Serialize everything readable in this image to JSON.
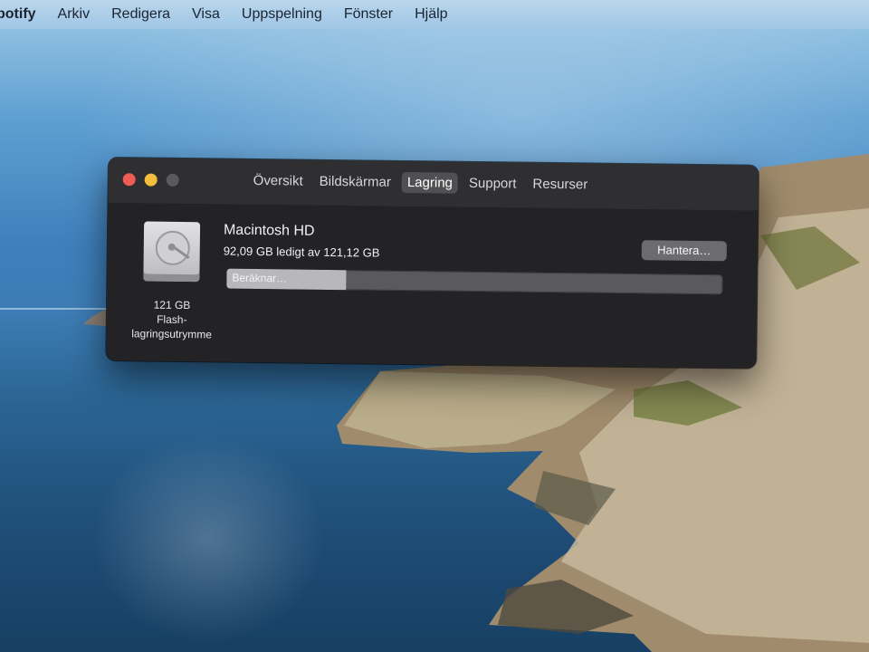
{
  "menubar": {
    "app_name": "potify",
    "items": [
      "Arkiv",
      "Redigera",
      "Visa",
      "Uppspelning",
      "Fönster",
      "Hjälp"
    ]
  },
  "window": {
    "tabs": [
      {
        "label": "Översikt",
        "active": false
      },
      {
        "label": "Bildskärmar",
        "active": false
      },
      {
        "label": "Lagring",
        "active": true
      },
      {
        "label": "Support",
        "active": false
      },
      {
        "label": "Resurser",
        "active": false
      }
    ],
    "disk": {
      "icon": "internal-drive-icon",
      "size_label": "121 GB",
      "type_line1": "Flash-",
      "type_line2": "lagringsutrymme",
      "name": "Macintosh HD",
      "usage": "92,09 GB ledigt av 121,12 GB",
      "manage_label": "Hantera…",
      "progress_label": "Beräknar…",
      "progress_fraction": 0.24
    }
  },
  "colors": {
    "close": "#ee5d54",
    "minimize": "#f3be3b",
    "zoom_disabled": "#5a5a5c",
    "window_bg": "#2b2b2d",
    "active_tab": "#505053"
  }
}
